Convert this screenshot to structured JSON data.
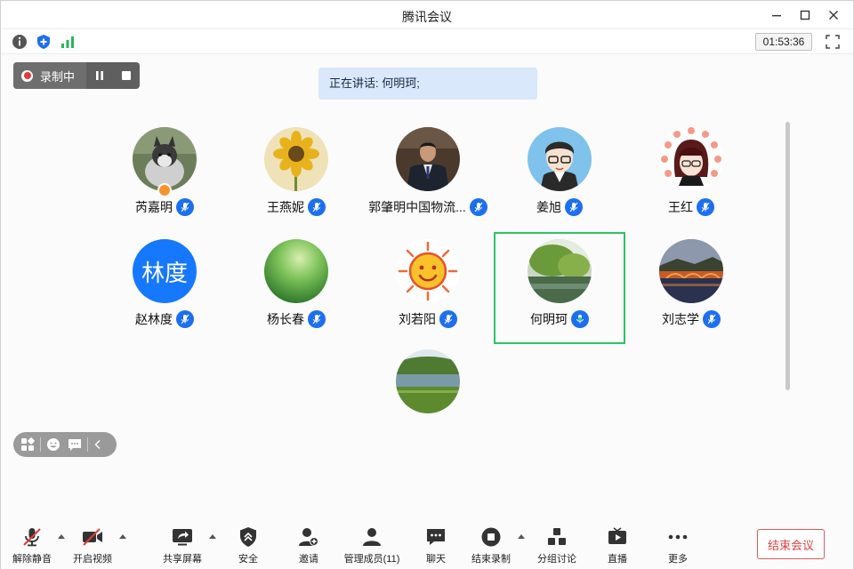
{
  "window": {
    "title": "腾讯会议"
  },
  "infobar": {
    "timer": "01:53:36"
  },
  "recording": {
    "status": "录制中"
  },
  "speaking": {
    "text": "正在讲话: 何明珂;"
  },
  "participants": [
    {
      "name": "芮嘉明"
    },
    {
      "name": "王燕妮"
    },
    {
      "name": "郭肇明中国物流..."
    },
    {
      "name": "姜旭"
    },
    {
      "name": "王红"
    },
    {
      "name": "赵林度",
      "avatar_text": "林度"
    },
    {
      "name": "杨长春"
    },
    {
      "name": "刘若阳"
    },
    {
      "name": "何明珂"
    },
    {
      "name": "刘志学"
    }
  ],
  "toolbar": {
    "unmute": "解除静音",
    "video": "开启视频",
    "share": "共享屏幕",
    "security": "安全",
    "invite": "邀请",
    "members": "管理成员(11)",
    "chat": "聊天",
    "end_record": "结束录制",
    "breakout": "分组讨论",
    "live": "直播",
    "more": "更多",
    "end_meeting": "结束会议"
  },
  "colors": {
    "accent": "#1d6ff0",
    "active_speaker_border": "#2cc46a",
    "end_meeting": "#e04040",
    "recording_dot": "#e23b3b"
  }
}
